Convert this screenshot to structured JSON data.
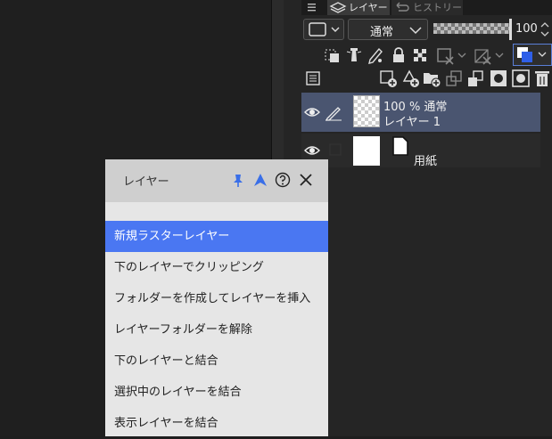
{
  "tabs": {
    "layer": "レイヤー",
    "history": "ヒストリー"
  },
  "properties": {
    "blend_mode": "通常",
    "opacity": "100"
  },
  "layers": [
    {
      "line1": "100 % 通常",
      "line2": "レイヤー 1"
    },
    {
      "name": "用紙"
    }
  ],
  "popup": {
    "title": "レイヤー",
    "items": [
      "新規ラスターレイヤー",
      "下のレイヤーでクリッピング",
      "フォルダーを作成してレイヤーを挿入",
      "レイヤーフォルダーを解除",
      "下のレイヤーと結合",
      "選択中のレイヤーを結合",
      "表示レイヤーを結合"
    ]
  },
  "colors": {
    "accent": "#4a77f2",
    "selected_layer": "#4a5570",
    "pin": "#3a6fe8"
  }
}
